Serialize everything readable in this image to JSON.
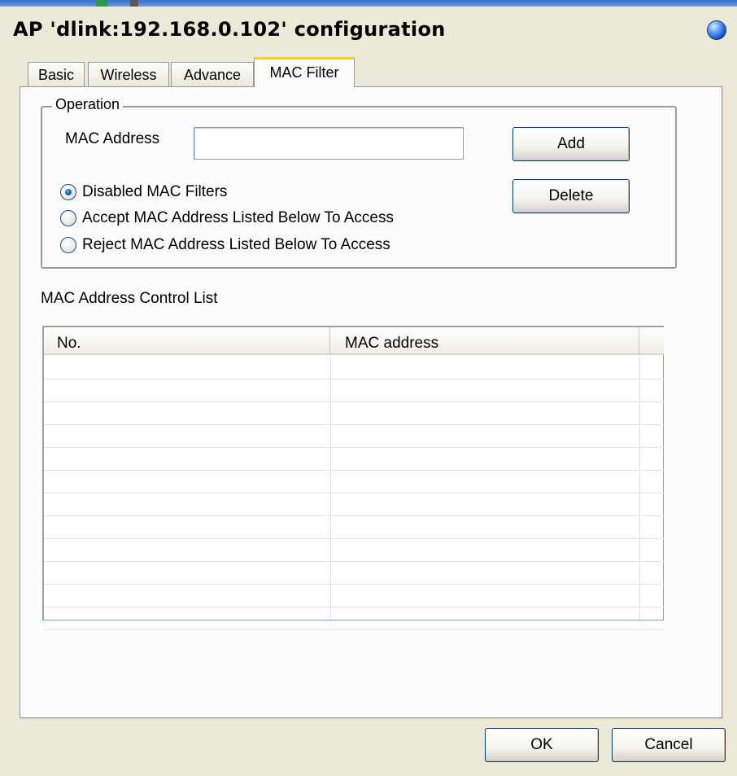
{
  "window": {
    "title": "AP 'dlink:192.168.0.102' configuration"
  },
  "tabs": [
    {
      "label": "Basic",
      "active": false
    },
    {
      "label": "Wireless",
      "active": false
    },
    {
      "label": "Advance",
      "active": false
    },
    {
      "label": "MAC Filter",
      "active": true
    }
  ],
  "operation": {
    "legend": "Operation",
    "mac_address_label": "MAC Address",
    "mac_address_value": "",
    "add_button": "Add",
    "delete_button": "Delete",
    "radios": [
      {
        "label": "Disabled MAC Filters",
        "checked": true
      },
      {
        "label": "Accept MAC Address Listed Below To Access",
        "checked": false
      },
      {
        "label": "Reject MAC Address Listed Below To Access",
        "checked": false
      }
    ]
  },
  "control_list": {
    "label": "MAC Address Control List",
    "columns": [
      "No.",
      "MAC address",
      ""
    ],
    "rows": []
  },
  "footer": {
    "ok_button": "OK",
    "cancel_button": "Cancel"
  },
  "colors": {
    "active_tab_highlight": "#ffc83c",
    "window_background": "#ece9d8",
    "button_border": "#003c74"
  }
}
